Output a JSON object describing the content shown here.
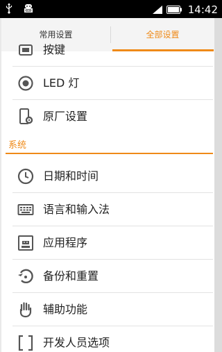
{
  "status_bar": {
    "time": "14:42",
    "left_icons": [
      "usb-icon",
      "android-debug-icon"
    ],
    "right_icons": [
      "signal-icon",
      "battery-icon"
    ]
  },
  "tabs": [
    {
      "label": "常用设置",
      "selected": false
    },
    {
      "label": "全部设置",
      "selected": true
    }
  ],
  "accent_color": "#ef8a18",
  "items_top": [
    {
      "label": "按键",
      "icon": "keys-icon"
    },
    {
      "label": "LED 灯",
      "icon": "led-icon"
    },
    {
      "label": "原厂设置",
      "icon": "factory-settings-icon"
    }
  ],
  "section": {
    "title": "系统"
  },
  "items_system": [
    {
      "label": "日期和时间",
      "icon": "clock-icon"
    },
    {
      "label": "语言和输入法",
      "icon": "keyboard-icon"
    },
    {
      "label": "应用程序",
      "icon": "apps-icon"
    },
    {
      "label": "备份和重置",
      "icon": "backup-icon"
    },
    {
      "label": "辅助功能",
      "icon": "hand-icon"
    },
    {
      "label": "开发人员选项",
      "icon": "developer-icon"
    }
  ]
}
